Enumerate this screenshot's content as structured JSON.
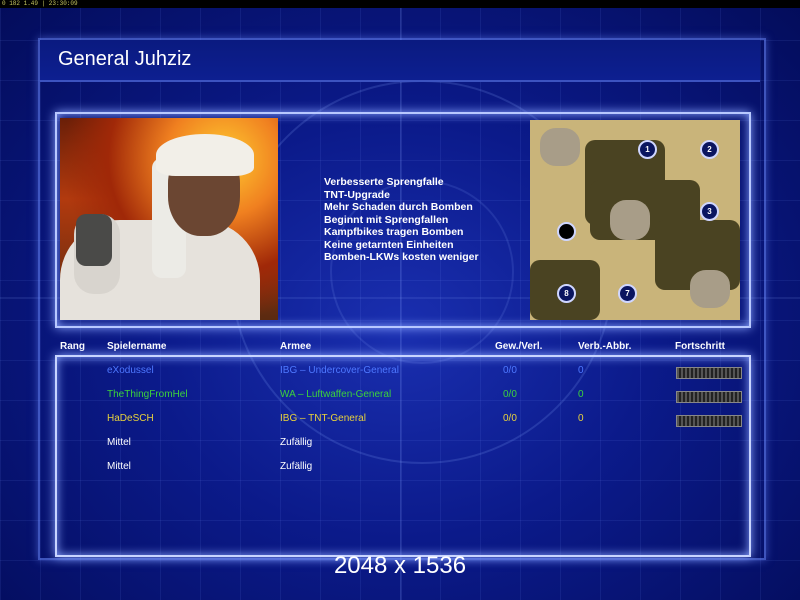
{
  "topbar": {
    "debug_text": "0 182 1.49 | 23:30:09"
  },
  "title": "General Juhziz",
  "traits": [
    "Verbesserte Sprengfalle",
    "TNT-Upgrade",
    "Mehr Schaden durch Bomben",
    "Beginnt mit Sprengfallen",
    "Kampfbikes tragen Bomben",
    "Keine getarnten Einheiten",
    "Bomben-LKWs kosten weniger"
  ],
  "map": {
    "markers": [
      "1",
      "2",
      "3",
      "",
      "8",
      "7"
    ]
  },
  "table": {
    "headers": {
      "rang": "Rang",
      "name": "Spielername",
      "armee": "Armee",
      "gew": "Gew./Verl.",
      "verb": "Verb.-Abbr.",
      "fort": "Fortschritt"
    },
    "rows": [
      {
        "name": "eXodussel",
        "armee": "IBG – Undercover-General",
        "gew": "0/0",
        "verb": "0",
        "color": "#4e78ff",
        "bar": true
      },
      {
        "name": "TheThingFromHel",
        "armee": "WA – Luftwaffen-General",
        "gew": "0/0",
        "verb": "0",
        "color": "#3cd23c",
        "bar": true
      },
      {
        "name": "HaDeSCH",
        "armee": "IBG – TNT-General",
        "gew": "0/0",
        "verb": "0",
        "color": "#e8d23c",
        "bar": true
      },
      {
        "name": "Mittel",
        "armee": "Zufällig",
        "gew": "",
        "verb": "",
        "color": "#ffffff",
        "bar": false
      },
      {
        "name": "Mittel",
        "armee": "Zufällig",
        "gew": "",
        "verb": "",
        "color": "#ffffff",
        "bar": false
      }
    ]
  },
  "resolution": "2048 x 1536",
  "colors": {
    "accent_glow": "#8aa4ff",
    "background": "#0b1a8a"
  }
}
